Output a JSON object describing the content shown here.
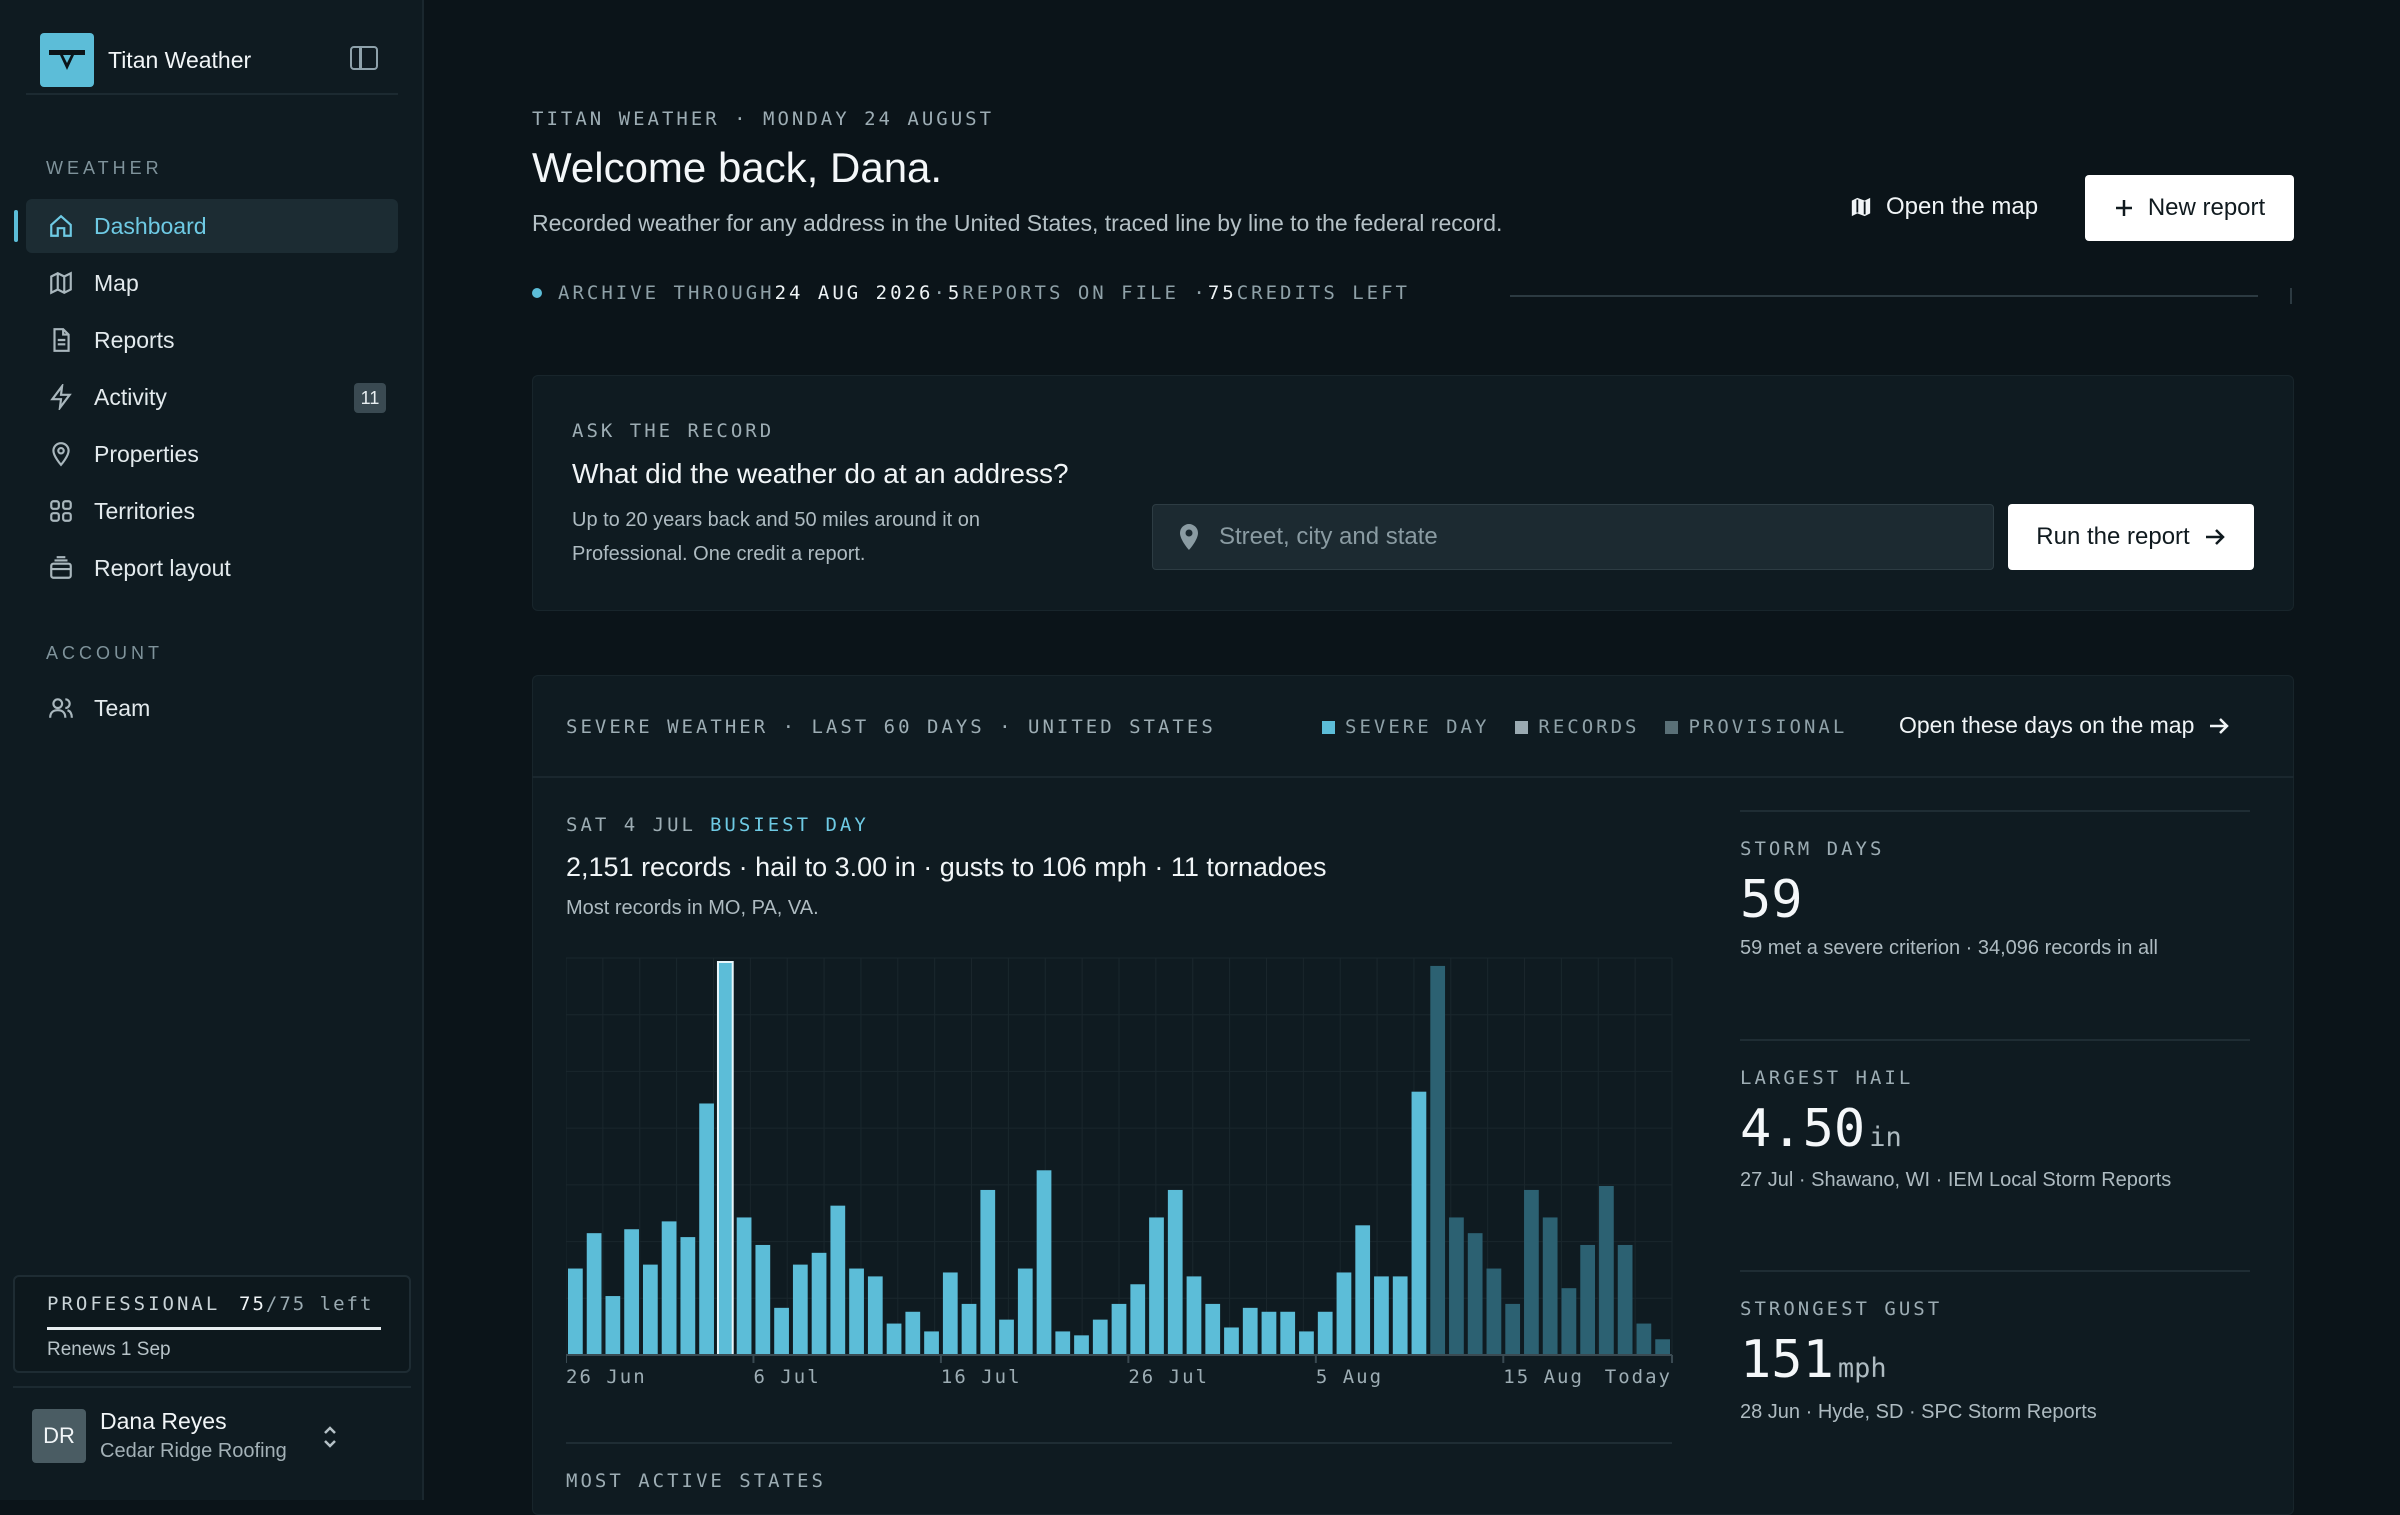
{
  "app": {
    "name": "Titan Weather"
  },
  "sidebar": {
    "weather_label": "WEATHER",
    "items": [
      {
        "label": "Dashboard",
        "icon": "home-icon",
        "active": true
      },
      {
        "label": "Map",
        "icon": "map-icon"
      },
      {
        "label": "Reports",
        "icon": "document-icon"
      },
      {
        "label": "Activity",
        "icon": "bolt-icon",
        "badge": "11"
      },
      {
        "label": "Properties",
        "icon": "location-pin-icon"
      },
      {
        "label": "Territories",
        "icon": "grid-icon"
      },
      {
        "label": "Report layout",
        "icon": "layers-icon"
      }
    ],
    "account_label": "ACCOUNT",
    "account_items": [
      {
        "label": "Team",
        "icon": "team-icon"
      }
    ],
    "plan": {
      "name": "PROFESSIONAL",
      "used": "75",
      "total": "/75 left",
      "renews": "Renews 1 Sep",
      "fraction": 1.0
    },
    "user": {
      "initials": "DR",
      "name": "Dana Reyes",
      "org": "Cedar Ridge Roofing"
    }
  },
  "header": {
    "eyebrow": "TITAN WEATHER · MONDAY 24 AUGUST",
    "title": "Welcome back, Dana.",
    "subtitle": "Recorded weather for any address in the United States, traced line by line to the federal record.",
    "open_map": "Open the map",
    "new_report": "New report"
  },
  "status": {
    "p1": "ARCHIVE THROUGH ",
    "archive": "24 AUG 2026",
    "p2": " · ",
    "reports": "5",
    "p3": " REPORTS ON FILE · ",
    "credits": "75",
    "p4": " CREDITS LEFT"
  },
  "ask": {
    "label": "ASK THE RECORD",
    "title": "What did the weather do at an address?",
    "desc": "Up to 20 years back and 50 miles around it on Professional. One credit a report.",
    "placeholder": "Street, city and state",
    "run": "Run the report"
  },
  "severe": {
    "label": "SEVERE WEATHER · LAST 60 DAYS · UNITED STATES",
    "legend": [
      "SEVERE DAY",
      "RECORDS",
      "PROVISIONAL"
    ],
    "open_days": "Open these days on the map",
    "busiest_date": "SAT 4 JUL",
    "busiest_tag": "BUSIEST DAY",
    "busiest_summary": "2,151 records · hail to 3.00 in · gusts to 106 mph · 11 tornadoes",
    "busiest_note": "Most records in MO, PA, VA.",
    "most_active_label": "MOST ACTIVE STATES"
  },
  "stats": [
    {
      "label": "STORM DAYS",
      "value": "59",
      "unit": "",
      "note": "59 met a severe criterion · 34,096 records in all"
    },
    {
      "label": "LARGEST HAIL",
      "value": "4.50",
      "unit": "in",
      "note": "27 Jul · Shawano, WI · IEM Local Storm Reports"
    },
    {
      "label": "STRONGEST GUST",
      "value": "151",
      "unit": "mph",
      "note": "28 Jun · Hyde, SD · SPC Storm Reports"
    }
  ],
  "colors": {
    "accent": "#5cbdd8",
    "records": "#9aaab1",
    "provisional": "#2c6172"
  },
  "chart_data": {
    "type": "bar",
    "x_tick_labels": [
      "26 Jun",
      "6 Jul",
      "16 Jul",
      "26 Jul",
      "5 Aug",
      "15 Aug",
      "Today"
    ],
    "x_tick_index": [
      0,
      10,
      20,
      30,
      40,
      50,
      58
    ],
    "highlight_index": 8,
    "provisional_from": 46,
    "values": [
      22,
      31,
      15,
      32,
      23,
      34,
      30,
      64,
      100,
      35,
      28,
      12,
      23,
      26,
      38,
      22,
      20,
      8,
      11,
      6,
      21,
      13,
      42,
      9,
      22,
      47,
      6,
      5,
      9,
      13,
      18,
      35,
      42,
      20,
      13,
      7,
      12,
      11,
      11,
      6,
      11,
      21,
      33,
      20,
      20,
      67,
      99,
      35,
      31,
      22,
      13,
      42,
      35,
      17,
      28,
      43,
      28,
      8,
      4
    ]
  }
}
